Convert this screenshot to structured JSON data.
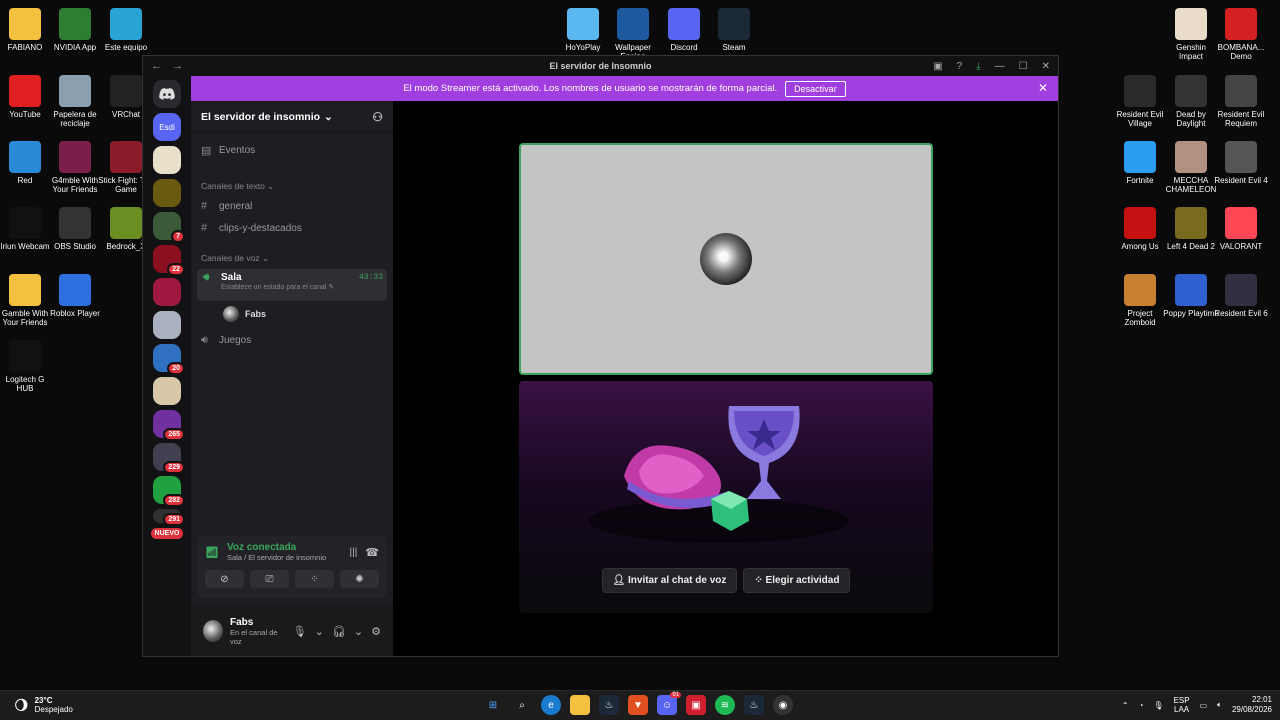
{
  "desktop": {
    "icons_left": [
      {
        "label": "FABIANO",
        "icon": "folder-icon",
        "color": "#f3c040"
      },
      {
        "label": "NVIDIA App",
        "icon": "nvidia-icon",
        "color": "#2e7d32"
      },
      {
        "label": "Este equipo",
        "icon": "computer-icon",
        "color": "#29a3d6"
      },
      {
        "label": "YouTube",
        "icon": "youtube-icon",
        "color": "#e02020"
      },
      {
        "label": "Papelera de reciclaje",
        "icon": "recycle-bin-icon",
        "color": "#8aa0b0"
      },
      {
        "label": "VRChat",
        "icon": "vrchat-icon",
        "color": "#222222"
      },
      {
        "label": "Red",
        "icon": "network-icon",
        "color": "#2b8ad8"
      },
      {
        "label": "G4mble With Your Friends",
        "icon": "winrar-icon",
        "color": "#7a1e4a"
      },
      {
        "label": "Stick Fight: The Game",
        "icon": "stickfight-icon",
        "color": "#8a1c2a"
      },
      {
        "label": "Iriun Webcam",
        "icon": "webcam-icon",
        "color": "#111111"
      },
      {
        "label": "OBS Studio",
        "icon": "obs-icon",
        "color": "#333333"
      },
      {
        "label": "Bedrock_X",
        "icon": "minecraft-icon",
        "color": "#6b8e23"
      },
      {
        "label": "Gamble With Your Friends",
        "icon": "folder-icon",
        "color": "#f3c040"
      },
      {
        "label": "Roblox Player",
        "icon": "roblox-icon",
        "color": "#2e6fe0"
      },
      {
        "label": "Logitech G HUB",
        "icon": "logitech-icon",
        "color": "#111111"
      }
    ],
    "icons_top": [
      {
        "label": "HoYoPlay",
        "icon": "hoyoplay-icon",
        "color": "#5bb8f0"
      },
      {
        "label": "Wallpaper Engine",
        "icon": "wallpaper-engine-icon",
        "color": "#1f5aa0"
      },
      {
        "label": "Discord",
        "icon": "discord-icon",
        "color": "#5865f2"
      },
      {
        "label": "Steam",
        "icon": "steam-icon",
        "color": "#1b2838"
      }
    ],
    "icons_right": [
      {
        "label": "Genshin Impact",
        "icon": "genshin-icon",
        "color": "#e8dcc8"
      },
      {
        "label": "BOMBANA... Demo",
        "icon": "bombana-icon",
        "color": "#d42020"
      },
      {
        "label": "Resident Evil Village",
        "icon": "re-village-icon",
        "color": "#2a2a2a"
      },
      {
        "label": "Dead by Daylight",
        "icon": "dbd-icon",
        "color": "#333333"
      },
      {
        "label": "Resident Evil Requiem",
        "icon": "re-requiem-icon",
        "color": "#444444"
      },
      {
        "label": "Fortnite",
        "icon": "fortnite-icon",
        "color": "#2a9ef0"
      },
      {
        "label": "MECCHA CHAMELEON",
        "icon": "chameleon-icon",
        "color": "#b49080"
      },
      {
        "label": "Resident Evil 4",
        "icon": "re4-icon",
        "color": "#555555"
      },
      {
        "label": "Among Us",
        "icon": "among-us-icon",
        "color": "#c51111"
      },
      {
        "label": "Left 4 Dead 2",
        "icon": "l4d2-icon",
        "color": "#7a6a20"
      },
      {
        "label": "VALORANT",
        "icon": "valorant-icon",
        "color": "#ff4655"
      },
      {
        "label": "Project Zomboid",
        "icon": "zomboid-icon",
        "color": "#c88030"
      },
      {
        "label": "Poppy Playtime",
        "icon": "poppy-icon",
        "color": "#3060d0"
      },
      {
        "label": "Resident Evil 6",
        "icon": "re6-icon",
        "color": "#303040"
      }
    ]
  },
  "window": {
    "title": "El servidor de Insomnio"
  },
  "banner": {
    "text": "El modo Streamer está activado. Los nombres de usuario se mostrarán de forma parcial.",
    "button": "Desactivar",
    "color": "#a03ee0"
  },
  "rail": {
    "active_label": "Esdi",
    "badges": [
      "7",
      "22",
      "20",
      "265",
      "229",
      "282",
      "291"
    ],
    "new_label": "NUEVO"
  },
  "sidebar": {
    "server_name": "El servidor de insomnio",
    "events": "Eventos",
    "text_category": "Canales de texto",
    "text_channels": [
      "general",
      "clips-y-destacados"
    ],
    "voice_category": "Canales de voz",
    "active_voice": {
      "name": "Sala",
      "time": "43:33",
      "status_hint": "Establece un estado para el canal"
    },
    "member": "Fabs",
    "other_voice": "Juegos"
  },
  "voice_panel": {
    "status": "Voz conectada",
    "location": "Sala / El servidor de insomnio"
  },
  "user": {
    "name": "Fabs",
    "status": "En el canal de voz"
  },
  "stage": {
    "invite_button": "Invitar al chat de voz",
    "activity_button": "Elegir actividad",
    "speaking_color": "#3ba55d"
  },
  "taskbar": {
    "temperature": "23°C",
    "weather": "Despejado",
    "lang_top": "ESP",
    "lang_bottom": "LAA",
    "time": "22:01",
    "date": "29/08/2026",
    "discord_badge": "91"
  }
}
